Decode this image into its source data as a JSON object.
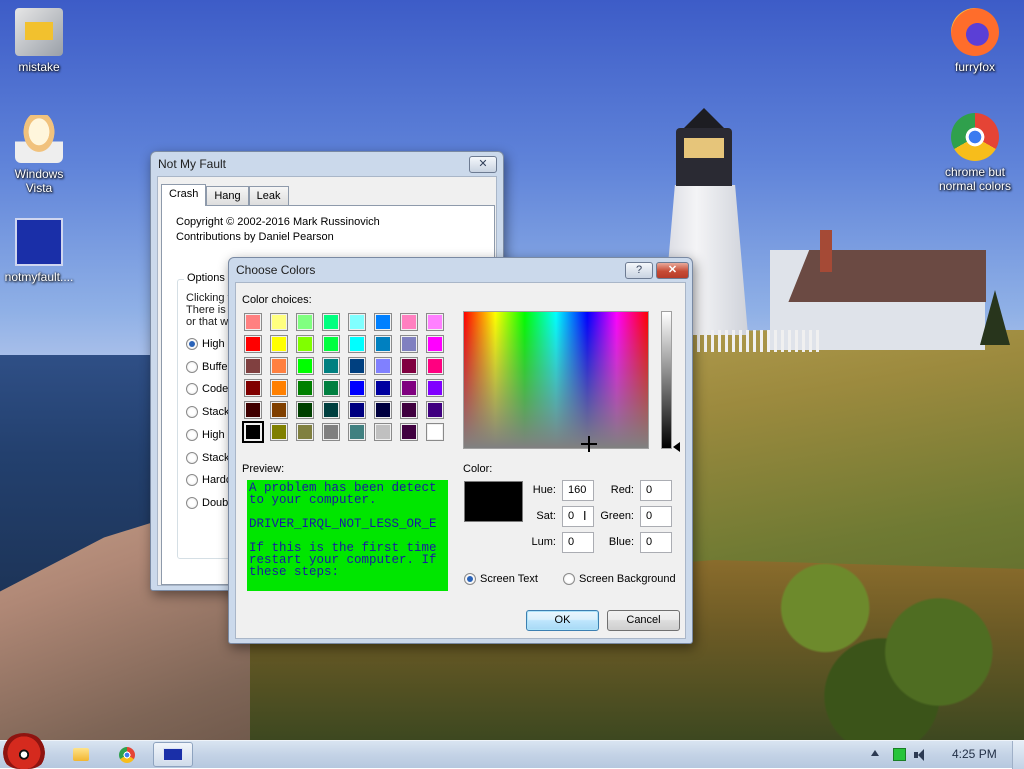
{
  "desktop": {
    "icons": [
      {
        "label": "mistake",
        "icon": "system-config-icon"
      },
      {
        "label": "Windows Vista",
        "icon": "egg-icon"
      },
      {
        "label": "notmyfault....",
        "icon": "bsod-icon"
      },
      {
        "label": "furryfox",
        "icon": "firefox-icon"
      },
      {
        "label": "chrome but normal colors",
        "icon": "chrome-icon"
      }
    ]
  },
  "not_my_fault": {
    "title": "Not My Fault",
    "close_glyph": "✕",
    "tabs": [
      {
        "label": "Crash",
        "active": true
      },
      {
        "label": "Hang",
        "active": false
      },
      {
        "label": "Leak",
        "active": false
      }
    ],
    "copyright": "Copyright © 2002-2016 Mark Russinovich",
    "contributions": "Contributions by Daniel Pearson",
    "options_label": "Options",
    "intro_lines": [
      "Clicking th",
      "There is a",
      "or that w"
    ],
    "options": [
      {
        "label": "High IR",
        "selected": true
      },
      {
        "label": "Buffer",
        "selected": false
      },
      {
        "label": "Code o",
        "selected": false
      },
      {
        "label": "Stack",
        "selected": false
      },
      {
        "label": "High IR",
        "selected": false
      },
      {
        "label": "Stack",
        "selected": false
      },
      {
        "label": "Hardc",
        "selected": false
      },
      {
        "label": "Double",
        "selected": false
      }
    ]
  },
  "choose_colors": {
    "title": "Choose Colors",
    "help_glyph": "?",
    "close_glyph": "✕",
    "color_choices_label": "Color choices:",
    "swatches": [
      "#ff8080",
      "#ffff80",
      "#80ff80",
      "#00ff80",
      "#80ffff",
      "#0080ff",
      "#ff80c0",
      "#ff80ff",
      "#ff0000",
      "#ffff00",
      "#80ff00",
      "#00ff40",
      "#00ffff",
      "#0080c0",
      "#8080c0",
      "#ff00ff",
      "#804040",
      "#ff8040",
      "#00ff00",
      "#008080",
      "#004080",
      "#8080ff",
      "#800040",
      "#ff0080",
      "#800000",
      "#ff8000",
      "#008000",
      "#008040",
      "#0000ff",
      "#0000a0",
      "#800080",
      "#8000ff",
      "#400000",
      "#804000",
      "#004000",
      "#004040",
      "#000080",
      "#000040",
      "#400040",
      "#400080",
      "#000000",
      "#808000",
      "#808040",
      "#808080",
      "#408080",
      "#c0c0c0",
      "#400040",
      "#ffffff"
    ],
    "selected_swatch": 40,
    "preview_label": "Preview:",
    "preview_text": "A problem has been detect\nto your computer.\n\nDRIVER_IRQL_NOT_LESS_OR_E\n\nIf this is the first time\nrestart your computer. If\nthese steps:",
    "preview_colors": {
      "background": "#00e600",
      "text": "#1a1aa0"
    },
    "color_label": "Color:",
    "current_color": "#000000",
    "hue_label": "Hue:",
    "hue": "160",
    "sat_label": "Sat:",
    "sat": "0",
    "lum_label": "Lum:",
    "lum": "0",
    "red_label": "Red:",
    "red": "0",
    "green_label": "Green:",
    "green": "0",
    "blue_label": "Blue:",
    "blue": "0",
    "target_options": [
      {
        "label": "Screen Text",
        "selected": true
      },
      {
        "label": "Screen Background",
        "selected": false
      }
    ],
    "ok_label": "OK",
    "cancel_label": "Cancel"
  },
  "taskbar": {
    "pinned": [
      "folder-icon",
      "chrome-icon",
      "notmyfault-icon"
    ],
    "clock": "4:25 PM"
  }
}
